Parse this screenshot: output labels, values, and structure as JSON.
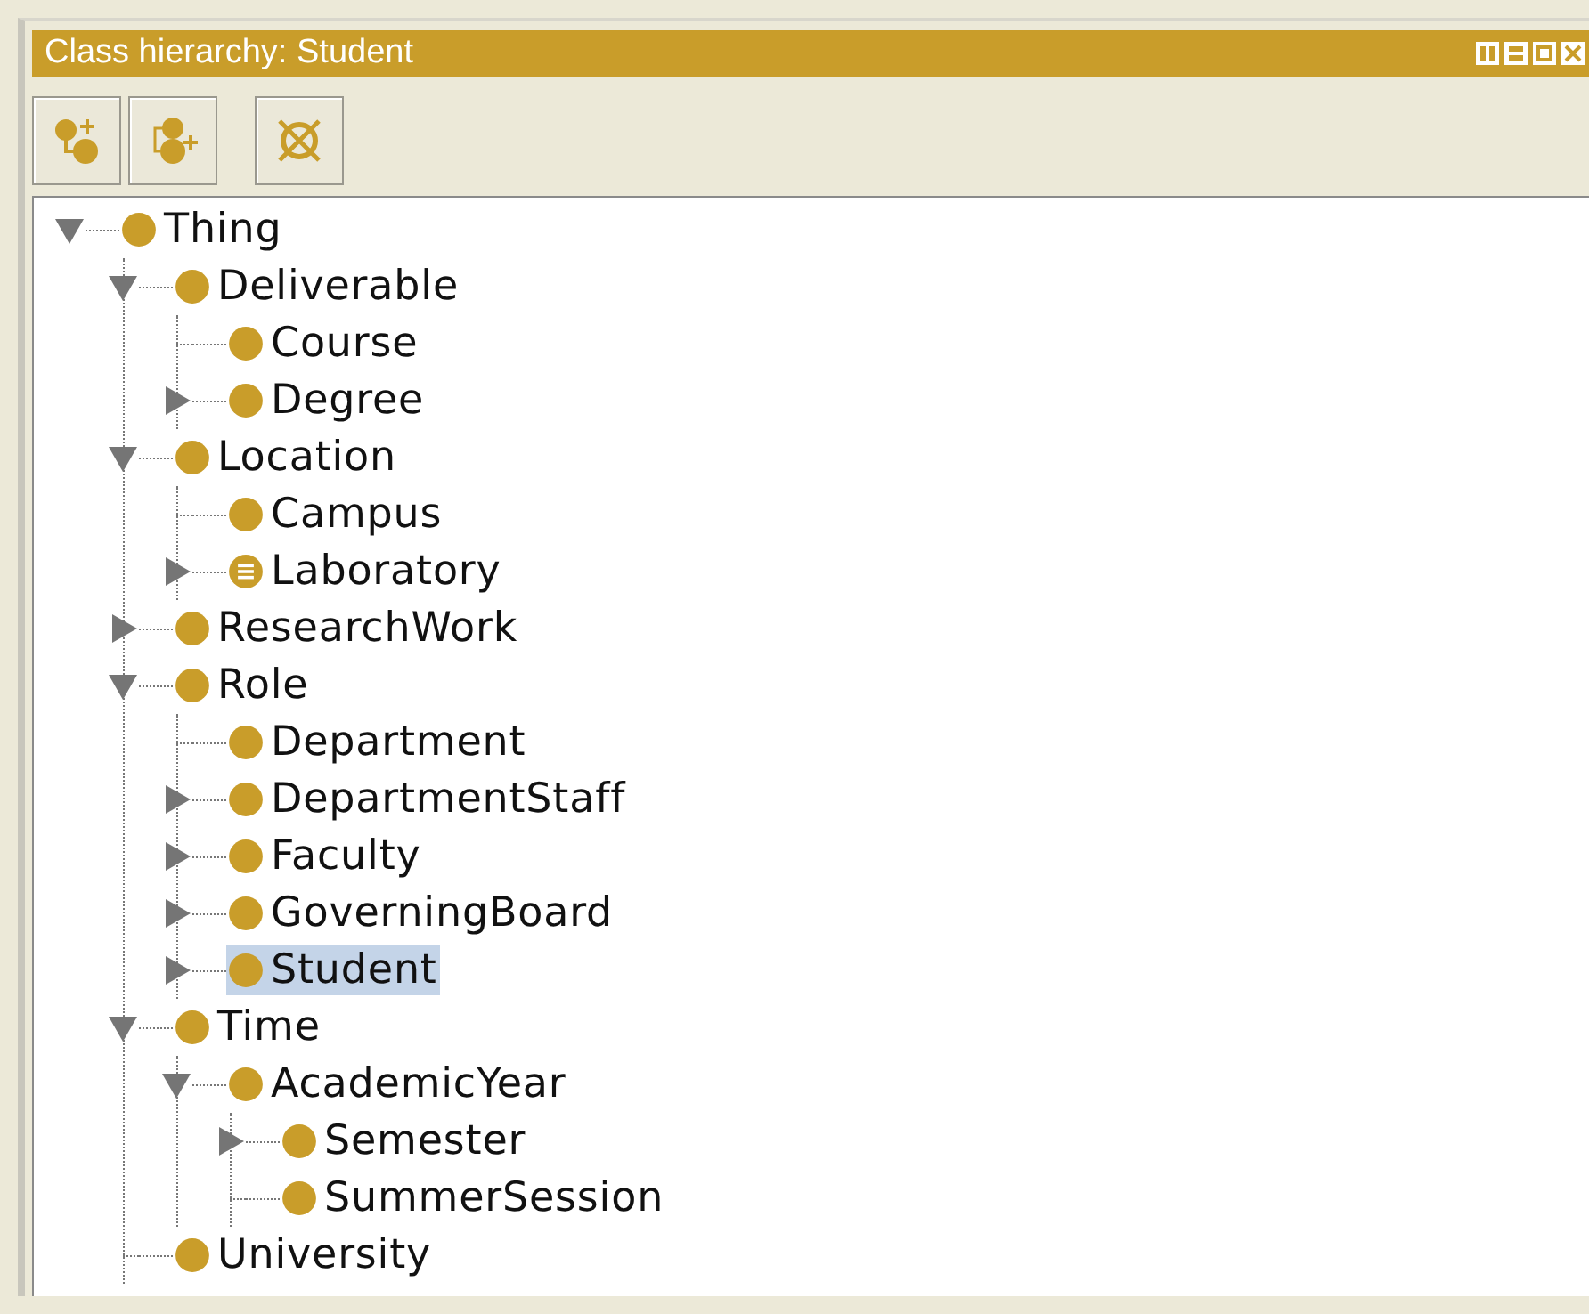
{
  "panel": {
    "title": "Class hierarchy: Student"
  },
  "tree": [
    {
      "label": "Thing",
      "kind": "class",
      "expanded": true,
      "selected": false,
      "children": [
        {
          "label": "Deliverable",
          "kind": "class",
          "expanded": true,
          "selected": false,
          "children": [
            {
              "label": "Course",
              "kind": "class",
              "selected": false
            },
            {
              "label": "Degree",
              "kind": "class",
              "expanded": false,
              "selected": false
            }
          ]
        },
        {
          "label": "Location",
          "kind": "class",
          "expanded": true,
          "selected": false,
          "children": [
            {
              "label": "Campus",
              "kind": "class",
              "selected": false
            },
            {
              "label": "Laboratory",
              "kind": "defined",
              "expanded": false,
              "selected": false
            }
          ]
        },
        {
          "label": "ResearchWork",
          "kind": "class",
          "expanded": false,
          "selected": false
        },
        {
          "label": "Role",
          "kind": "class",
          "expanded": true,
          "selected": false,
          "children": [
            {
              "label": "Department",
              "kind": "class",
              "selected": false
            },
            {
              "label": "DepartmentStaff",
              "kind": "class",
              "expanded": false,
              "selected": false
            },
            {
              "label": "Faculty",
              "kind": "class",
              "expanded": false,
              "selected": false
            },
            {
              "label": "GoverningBoard",
              "kind": "class",
              "expanded": false,
              "selected": false
            },
            {
              "label": "Student",
              "kind": "class",
              "expanded": false,
              "selected": true
            }
          ]
        },
        {
          "label": "Time",
          "kind": "class",
          "expanded": true,
          "selected": false,
          "children": [
            {
              "label": "AcademicYear",
              "kind": "class",
              "expanded": true,
              "selected": false,
              "children": [
                {
                  "label": "Semester",
                  "kind": "class",
                  "expanded": false,
                  "selected": false
                },
                {
                  "label": "SummerSession",
                  "kind": "class",
                  "selected": false
                }
              ]
            }
          ]
        },
        {
          "label": "University",
          "kind": "class",
          "selected": false
        }
      ]
    }
  ]
}
